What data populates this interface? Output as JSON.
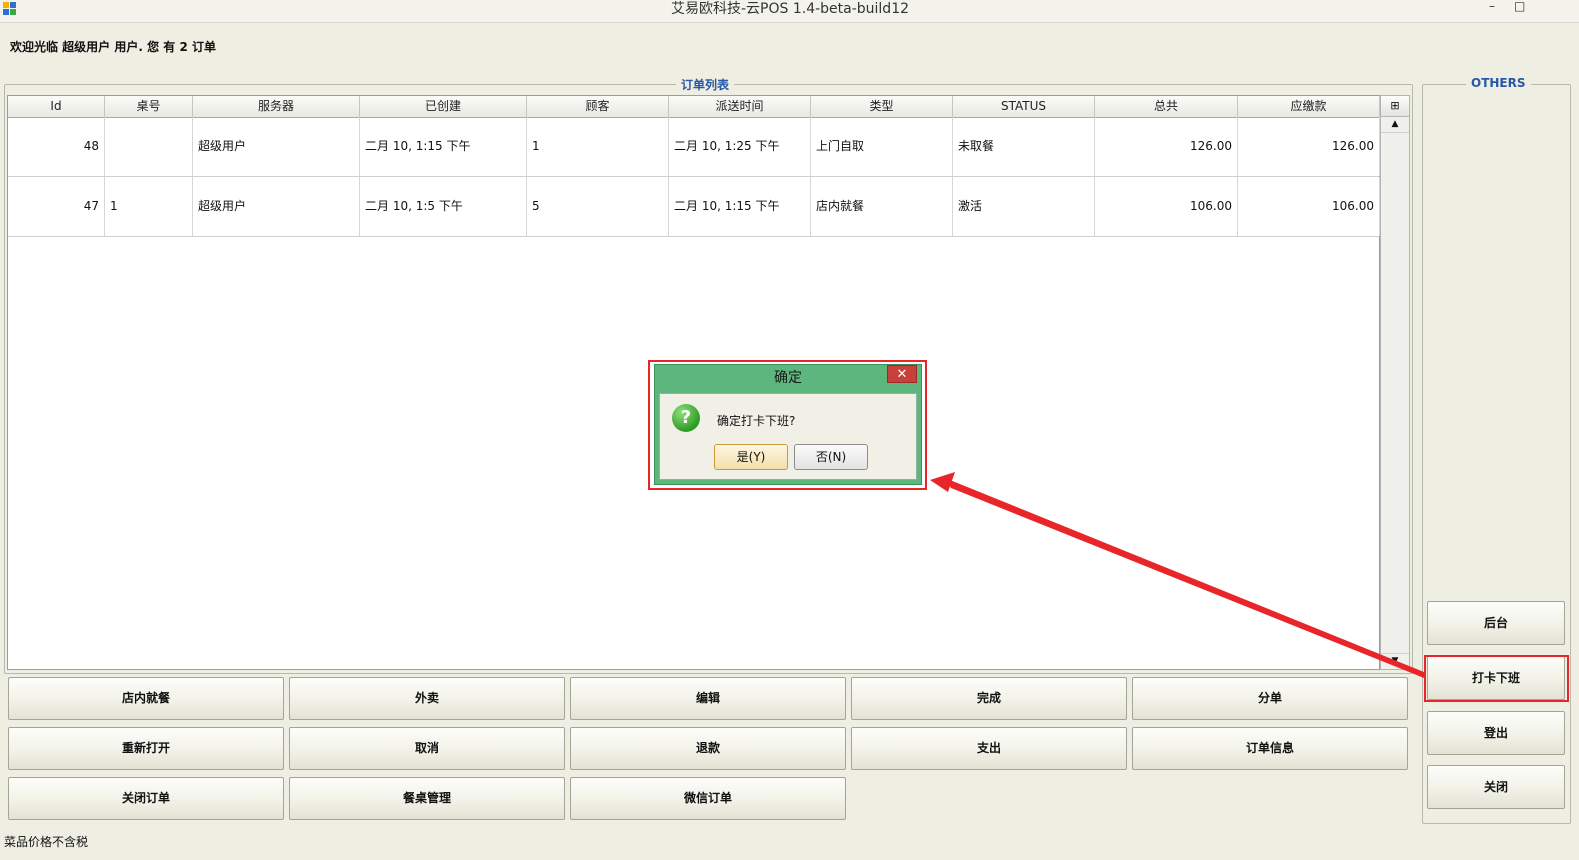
{
  "window": {
    "title": "艾易欧科技-云POS 1.4-beta-build12",
    "minimize_glyph": "–",
    "maximize_glyph": "□"
  },
  "welcome_text": "欢迎光临 超级用户 用户. 您 有 2 订单",
  "orders_panel": {
    "title": "订单列表",
    "columns": [
      "Id",
      "桌号",
      "服务器",
      "已创建",
      "顾客",
      "派送时间",
      "类型",
      "STATUS",
      "总共",
      "应缴款"
    ],
    "rows": [
      {
        "id": "48",
        "table": "",
        "server": "超级用户",
        "created": "二月 10, 1:15 下午",
        "customer": "1",
        "delivery": "二月 10, 1:25 下午",
        "type": "上门自取",
        "status": "未取餐",
        "total": "126.00",
        "due": "126.00"
      },
      {
        "id": "47",
        "table": "1",
        "server": "超级用户",
        "created": "二月 10, 1:5 下午",
        "customer": "5",
        "delivery": "二月 10, 1:15 下午",
        "type": "店内就餐",
        "status": "激活",
        "total": "106.00",
        "due": "106.00"
      }
    ]
  },
  "scrollbar": {
    "corner_glyph": "⊞",
    "up_glyph": "▲",
    "down_glyph": "▼"
  },
  "action_buttons": {
    "dine_in": "店内就餐",
    "takeaway": "外卖",
    "edit": "编辑",
    "complete": "完成",
    "split": "分单",
    "reopen": "重新打开",
    "cancel": "取消",
    "refund": "退款",
    "expense": "支出",
    "order_info": "订单信息",
    "close_order": "关闭订单",
    "table_mgmt": "餐桌管理",
    "wechat_order": "微信订单"
  },
  "others_panel": {
    "title": "OTHERS",
    "backend": "后台",
    "clock_out": "打卡下班",
    "logout": "登出",
    "close": "关闭"
  },
  "status_bar": "菜品价格不含税",
  "dialog": {
    "title": "确定",
    "close_glyph": "✕",
    "icon_glyph": "?",
    "message": "确定打卡下班?",
    "yes_label": "是(Y)",
    "no_label": "否(N)"
  },
  "colors": {
    "highlight_red": "#e8262a",
    "dialog_green": "#5cb67e",
    "legend_blue": "#2757a8"
  }
}
